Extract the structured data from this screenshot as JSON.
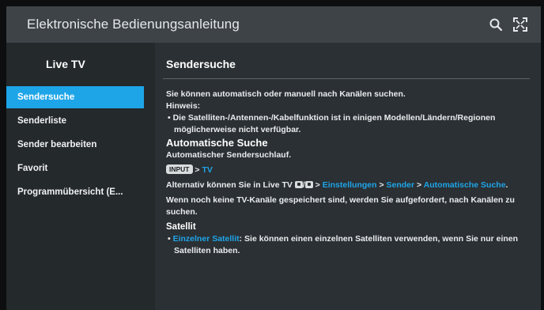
{
  "window": {
    "title": "Elektronische Bedienungsanleitung",
    "icons": [
      "search-icon",
      "expand-icon"
    ]
  },
  "sidebar": {
    "title": "Live TV",
    "items": [
      {
        "label": "Sendersuche",
        "active": true
      },
      {
        "label": "Senderliste",
        "active": false
      },
      {
        "label": "Sender bearbeiten",
        "active": false
      },
      {
        "label": "Favorit",
        "active": false
      },
      {
        "label": "Programmübersicht (E...",
        "active": false
      }
    ]
  },
  "content": {
    "title": "Sendersuche",
    "intro": "Sie können automatisch oder manuell nach Kanälen suchen.",
    "hint_label": "Hinweis:",
    "hint_text": "Die Satelliten-/Antennen-/Kabelfunktion ist in einigen Modellen/Ländern/Regionen möglicherweise nicht verfügbar.",
    "auto_heading": "Automatische Suche",
    "auto_desc": "Automatischer Sendersuchlauf.",
    "path_key": "INPUT",
    "path_sep": " > ",
    "path_link": "TV",
    "alt_prefix": "Alternativ können Sie in Live TV ",
    "alt_slash": "/",
    "alt_sep1": " > ",
    "alt_link1": "Einstellungen",
    "alt_sep2": " > ",
    "alt_link2": "Sender",
    "alt_sep3": " > ",
    "alt_link3": "Automatische Suche",
    "alt_end": ".",
    "no_channels": "Wenn noch keine TV-Kanäle gespeichert sind, werden Sie aufgefordert, nach Kanälen zu suchen.",
    "satellite_heading": "Satellit",
    "sat_link": "Einzelner Satellit",
    "sat_text": ": Sie können einen einzelnen Satelliten verwenden, wenn Sie nur einen Satelliten haben."
  },
  "colors": {
    "accent": "#1ea5e8",
    "topbar": "#3d4347",
    "sidebar": "#24292c",
    "content": "#2b3034"
  }
}
